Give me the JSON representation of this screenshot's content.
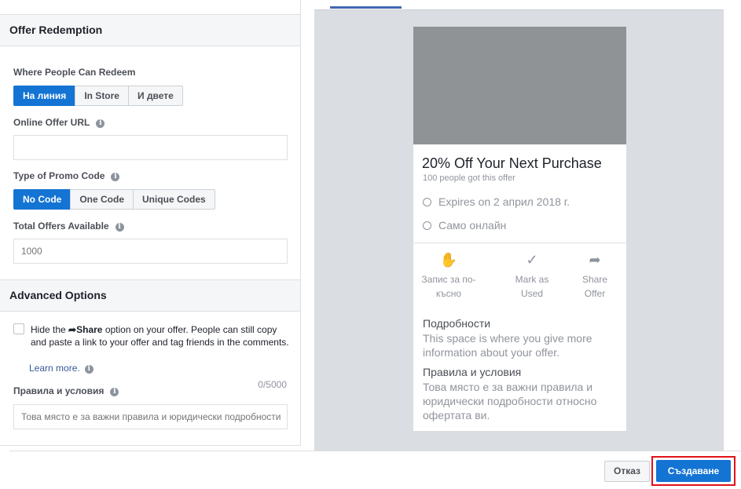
{
  "offer_redemption": {
    "title": "Offer Redemption",
    "where_label": "Where People Can Redeem",
    "where_options": [
      "На линия",
      "In Store",
      "И двете"
    ],
    "url_label": "Online Offer URL",
    "url_value": "",
    "promo_label": "Type of Promo Code",
    "promo_options": [
      "No Code",
      "One Code",
      "Unique Codes"
    ],
    "total_label": "Total Offers Available",
    "total_placeholder": "1000"
  },
  "advanced": {
    "title": "Advanced Options",
    "hide_text_1": "Hide the",
    "share_word": "Share",
    "hide_text_2": "option on your offer. People can still copy and paste a link to your offer and tag friends in the comments.",
    "learn_more": "Learn more.",
    "terms_label": "Правила и условия",
    "terms_counter": "0/5000",
    "terms_placeholder": "Това място е за важни правила и юридически подробности"
  },
  "preview": {
    "title": "20% Off Your Next Purchase",
    "claimed": "100 people got this offer",
    "expires": "Expires on 2 април 2018 г.",
    "online_only": "Само онлайн",
    "actions": [
      {
        "label_1": "Запис за по-",
        "label_2": "късно",
        "icon": "save-hand-icon"
      },
      {
        "label_1": "Mark as",
        "label_2": "Used",
        "icon": "checkmark-icon"
      },
      {
        "label_1": "Share",
        "label_2": "Offer",
        "icon": "share-arrow-icon"
      }
    ],
    "details_heading": "Подробности",
    "details_text": "This space is where you give more information about your offer.",
    "terms_heading": "Правила и условия",
    "terms_text": "Това място е за важни правила и юридически подробности относно офертата ви."
  },
  "footer": {
    "cancel": "Отказ",
    "create": "Създаване"
  },
  "colors": {
    "accent": "#1474d4",
    "highlight": "#e0121a"
  }
}
